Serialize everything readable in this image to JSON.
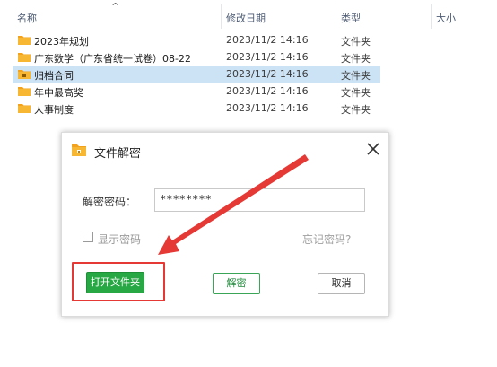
{
  "columns": {
    "name": "名称",
    "modified": "修改日期",
    "type": "类型",
    "size": "大小"
  },
  "files": [
    {
      "name": "2023年规划",
      "modified": "2023/11/2 14:16",
      "type": "文件夹",
      "selected": false,
      "locked": false
    },
    {
      "name": "广东数学（广东省统一试卷）08-22",
      "modified": "2023/11/2 14:16",
      "type": "文件夹",
      "selected": false,
      "locked": false
    },
    {
      "name": "归档合同",
      "modified": "2023/11/2 14:16",
      "type": "文件夹",
      "selected": true,
      "locked": true
    },
    {
      "name": "年中最高奖",
      "modified": "2023/11/2 14:16",
      "type": "文件夹",
      "selected": false,
      "locked": false
    },
    {
      "name": "人事制度",
      "modified": "2023/11/2 14:16",
      "type": "文件夹",
      "selected": false,
      "locked": false
    }
  ],
  "dialog": {
    "title": "文件解密",
    "password_label": "解密密码：",
    "password_value": "********",
    "show_password_label": "显示密码",
    "show_password_checked": false,
    "forgot_password": "忘记密码?",
    "open_folder_button": "打开文件夹",
    "decrypt_button": "解密",
    "cancel_button": "取消"
  },
  "icons": {
    "folder": "folder-icon",
    "sort": "sort-ascending-icon",
    "close": "close-icon",
    "locked_folder": "locked-folder-icon"
  },
  "colors": {
    "folder": "#f2a21d",
    "selection": "#cce2f5",
    "primary_button": "#27a844",
    "annotation": "#e53935"
  }
}
